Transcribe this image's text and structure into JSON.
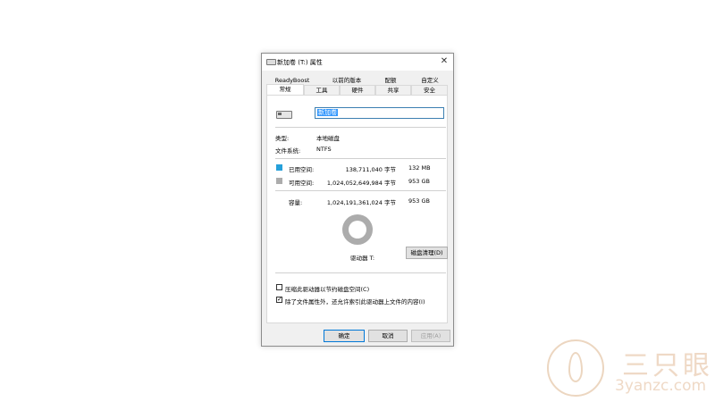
{
  "window": {
    "title": "新加卷 (T:) 属性",
    "close_glyph": "✕"
  },
  "tabs": {
    "row1": [
      "ReadyBoost",
      "以前的版本",
      "配额",
      "自定义"
    ],
    "row2": [
      "常规",
      "工具",
      "硬件",
      "共享",
      "安全"
    ],
    "active": "常规"
  },
  "general": {
    "volume_name": "新加卷",
    "type_label": "类型:",
    "type_value": "本地磁盘",
    "fs_label": "文件系统:",
    "fs_value": "NTFS",
    "used": {
      "label": "已用空间:",
      "bytes": "138,711,040 字节",
      "size": "132 MB",
      "color": "#26a0da"
    },
    "free": {
      "label": "可用空间:",
      "bytes": "1,024,052,649,984 字节",
      "size": "953 GB",
      "color": "#acacac"
    },
    "capacity": {
      "label": "容量:",
      "bytes": "1,024,191,361,024 字节",
      "size": "953 GB"
    },
    "used_fraction": 0.000135,
    "drive_label": "驱动器 T:",
    "cleanup_button": "磁盘清理(D)",
    "compress_label": "压缩此驱动器以节约磁盘空间(C)",
    "compress_checked": false,
    "index_label": "除了文件属性外，还允许索引此驱动器上文件的内容(I)",
    "index_checked": true,
    "check_glyph": "✓"
  },
  "buttons": {
    "ok": "确定",
    "cancel": "取消",
    "apply": "应用(A)"
  },
  "watermark": {
    "brand": "三只眼",
    "url": "3yanzc.com"
  }
}
